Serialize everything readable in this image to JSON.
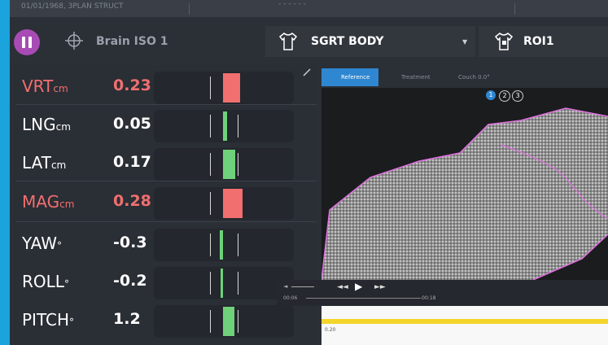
{
  "topbar": {
    "breadcrumb": "01/01/1968, 3PLAN STRUCT",
    "center_text": "- - - - - -"
  },
  "header": {
    "plan_name": "Brain ISO 1",
    "surface_select": "SGRT BODY",
    "roi_select": "ROI1"
  },
  "rows": [
    {
      "label": "VRT",
      "unit": "cm",
      "value": "0.23",
      "alert": true,
      "bar_value": 0.23
    },
    {
      "label": "LNG",
      "unit": "cm",
      "value": "0.05",
      "alert": false,
      "bar_value": 0.05
    },
    {
      "label": "LAT",
      "unit": "cm",
      "value": "0.17",
      "alert": false,
      "bar_value": 0.17
    },
    {
      "label": "MAG",
      "unit": "cm",
      "value": "0.28",
      "alert": true,
      "bar_value": 0.28
    },
    {
      "label": "YAW",
      "unit": "°",
      "value": "-0.3",
      "alert": false,
      "bar_value": -0.3
    },
    {
      "label": "ROLL",
      "unit": "°",
      "value": "-0.2",
      "alert": false,
      "bar_value": -0.2
    },
    {
      "label": "PITCH",
      "unit": "°",
      "value": "1.2",
      "alert": false,
      "bar_value": 1.2
    }
  ],
  "tabs": [
    {
      "label": "Reference",
      "active": true
    },
    {
      "label": "Treatment",
      "active": false
    },
    {
      "label": "Couch 0.0°",
      "active": false
    }
  ],
  "steps": [
    "1",
    "2",
    "3"
  ],
  "playback": {
    "start_time": "00:06",
    "end_time": "-00:18"
  },
  "timeline": {
    "label": "0.20"
  },
  "colors": {
    "accent": "#a84bb5",
    "alert": "#f16f6f",
    "ok": "#6fd17a",
    "active_tab": "#2f86d1",
    "timeline_bar": "#f4d52a"
  }
}
